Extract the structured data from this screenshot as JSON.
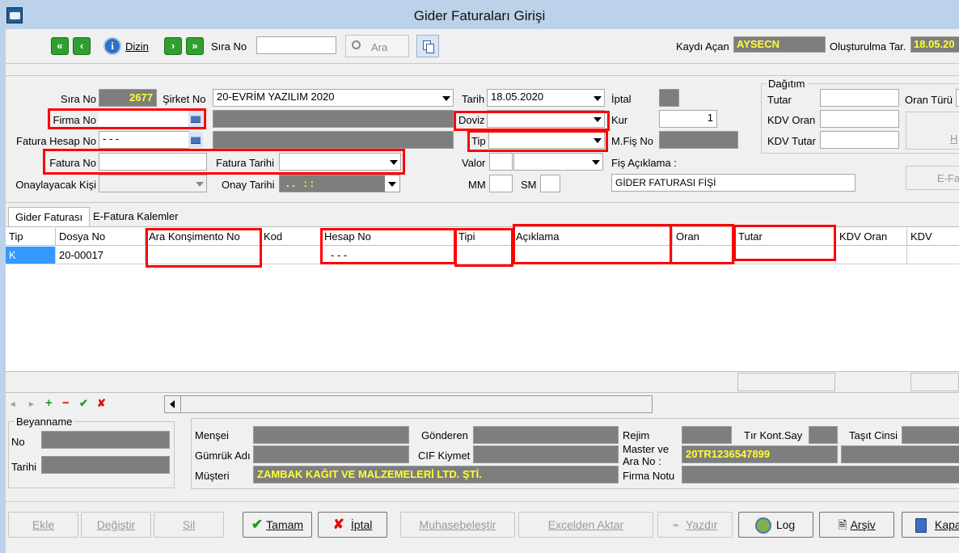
{
  "window": {
    "title": "Gider Faturaları Girişi"
  },
  "toolbar": {
    "dizin_label": "Dizin",
    "sira_no_label": "Sıra No",
    "sira_no_value": "",
    "ara_label": "Ara",
    "kaydi_acan_label": "Kaydı Açan",
    "kaydi_acan_value": "AYSECN",
    "olusturulma_label": "Oluşturulma Tar.",
    "olusturulma_value": "18.05.20"
  },
  "form": {
    "sira_no_label": "Sıra No",
    "sira_no_value": "2677",
    "sirket_no_label": "Şirket No",
    "sirket_no_value": "20-EVRİM YAZILIM  2020",
    "tarih_label": "Tarih",
    "tarih_value": "18.05.2020",
    "iptal_label": "İptal",
    "firma_no_label": "Firma No",
    "firma_no_value": "",
    "doviz_label": "Doviz",
    "doviz_value": "",
    "kur_label": "Kur",
    "kur_value": "1",
    "fatura_hesap_no_label": "Fatura Hesap No",
    "fatura_hesap_no_value": "- - -",
    "tip_label": "Tip",
    "tip_value": "",
    "mfis_no_label": "M.Fiş No",
    "fatura_no_label": "Fatura No",
    "fatura_no_value": "",
    "fatura_tarihi_label": "Fatura Tarihi",
    "fatura_tarihi_value": "",
    "valor_label": "Valor",
    "fis_aciklama_label": "Fiş Açıklama :",
    "fis_aciklama_value": "GİDER FATURASI FİŞİ",
    "onaylayacak_label": "Onaylayacak Kişi",
    "onay_tarihi_label": "Onay Tarihi",
    "onay_tarihi_value": ". .   : :",
    "mm_label": "MM",
    "sm_label": "SM"
  },
  "dagitim": {
    "title": "Dağıtım",
    "tutar_label": "Tutar",
    "oran_turu_label": "Oran Türü",
    "kdv_oran_label": "KDV Oran",
    "kdv_tutar_label": "KDV Tutar",
    "h_button": "H",
    "efa_button": "E-Fa"
  },
  "tabs": [
    "Gider Faturası",
    "E-Fatura Kalemler"
  ],
  "grid": {
    "columns": [
      "Tip",
      "Dosya No",
      "Ara Konşimento No",
      "Kod",
      "Hesap No",
      "Tipi",
      "Açıklama",
      "Oran",
      "Tutar",
      "KDV Oran",
      "KDV"
    ],
    "rows": [
      [
        "K",
        "20-00017",
        "",
        "",
        "- - -",
        "",
        "",
        "",
        "",
        "",
        ""
      ]
    ]
  },
  "beyanname": {
    "title": "Beyanname",
    "no_label": "No",
    "tarihi_label": "Tarihi"
  },
  "details": {
    "mensei_label": "Menşei",
    "gonderen_label": "Gönderen",
    "rejim_label": "Rejim",
    "tir_kont_label": "Tır Kont.Say",
    "tasit_cinsi_label": "Taşıt Cinsi",
    "gumruk_adi_label": "Gümrük Adı",
    "cif_kiymet_label": "CIF Kiymet",
    "master_label_1": "Master ve",
    "master_label_2": "Ara No :",
    "master_value": "20TR1236547899",
    "musteri_label": "Müşteri",
    "musteri_value": "ZAMBAK KAĞIT VE MALZEMELERİ LTD. ŞTİ.",
    "firma_notu_label": "Firma Notu"
  },
  "buttons": {
    "ekle": "Ekle",
    "degistir": "Değiştir",
    "sil": "Sil",
    "tamam": "Tamam",
    "iptal": "İptal",
    "muhasebelestir": "Muhasebeleştir",
    "excel": "Excelden Aktar",
    "yazdir": "Yazdır",
    "log": "Log",
    "arsiv": "Arşiv",
    "kapat": "Kapa"
  },
  "colors": {
    "highlight": "#ff0000",
    "readonly_bg": "#7e7e7e",
    "readonly_text": "#ffff30",
    "selected_cell": "#3399ff"
  }
}
